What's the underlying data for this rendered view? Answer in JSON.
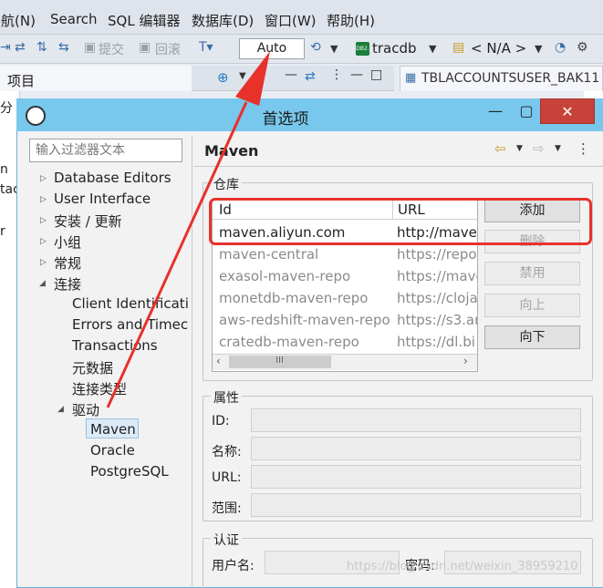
{
  "menubar": {
    "items": [
      "导航(N)",
      "Search",
      "SQL 编辑器",
      "数据库(D)",
      "窗口(W)",
      "帮助(H)"
    ]
  },
  "toolbar": {
    "commit": "提交",
    "rollback": "回滚",
    "transaction_mode": "Auto",
    "datasource": "tracdb",
    "schema": "< N/A >",
    "db_badge": "DB2."
  },
  "left_pane": {
    "title": "项目",
    "clipped_text": [
      "分",
      "n",
      "tac",
      "r"
    ]
  },
  "editor_tab": {
    "label": "TBLACCOUNTSUSER_BAK11"
  },
  "dialog": {
    "title": "首选项",
    "filter_placeholder": "输入过滤器文本",
    "tree": {
      "database_editors": "Database Editors",
      "user_interface": "User Interface",
      "install_update": "安装 / 更新",
      "group": "小组",
      "general": "常规",
      "connections": "连接",
      "client_identification": "Client Identificati",
      "errors_timeouts": "Errors and Timec",
      "transactions": "Transactions",
      "metadata": "元数据",
      "connection_types": "连接类型",
      "drivers": "驱动",
      "maven": "Maven",
      "oracle": "Oracle",
      "postgresql": "PostgreSQL"
    },
    "page": {
      "title": "Maven",
      "repository_group": "仓库",
      "table": {
        "columns": [
          "Id",
          "URL"
        ],
        "rows": [
          {
            "id": "maven.aliyun.com",
            "url": "http://maven"
          },
          {
            "id": "maven-central",
            "url": "https://repo"
          },
          {
            "id": "exasol-maven-repo",
            "url": "https://mave"
          },
          {
            "id": "monetdb-maven-repo",
            "url": "https://cloja"
          },
          {
            "id": "aws-redshift-maven-repo",
            "url": "https://s3.ar"
          },
          {
            "id": "cratedb-maven-repo",
            "url": "https://dl.bi"
          }
        ],
        "scroll_label": "III"
      },
      "buttons": {
        "add": "添加",
        "delete": "删除",
        "disable": "禁用",
        "up": "向上",
        "down": "向下"
      },
      "properties_group": "属性",
      "properties": {
        "id_label": "ID:",
        "name_label": "名称:",
        "url_label": "URL:",
        "scope_label": "范围:"
      },
      "auth_group": "认证",
      "auth": {
        "user_label": "用户名:",
        "password_label": "密码:"
      }
    }
  },
  "watermark": "https://blog.csdn.net/weixin_38959210",
  "colors": {
    "title_bar": "#78c7ed",
    "annotation_red": "#e8312a",
    "close_button": "#c7433a"
  }
}
